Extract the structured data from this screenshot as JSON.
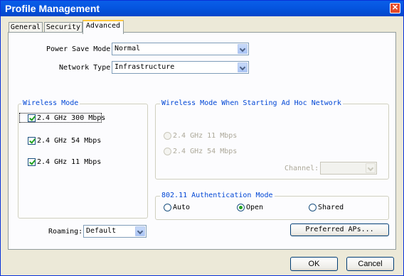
{
  "window": {
    "title": "Profile Management",
    "close_glyph": "✕"
  },
  "tabs": [
    {
      "label": "General",
      "active": false
    },
    {
      "label": "Security",
      "active": false
    },
    {
      "label": "Advanced",
      "active": true
    }
  ],
  "power_save": {
    "label": "Power Save Mode:",
    "value": "Normal"
  },
  "network_type": {
    "label": "Network Type:",
    "value": "Infrastructure"
  },
  "wireless_mode": {
    "legend": "Wireless Mode",
    "options": [
      {
        "label": "2.4 GHz 300 Mbps",
        "checked": true
      },
      {
        "label": "2.4 GHz 54 Mbps",
        "checked": true
      },
      {
        "label": "2.4 GHz 11 Mbps",
        "checked": true
      }
    ]
  },
  "adhoc_mode": {
    "legend": "Wireless Mode When Starting Ad Hoc Network",
    "options": [
      {
        "label": "2.4 GHz 11 Mbps",
        "enabled": false
      },
      {
        "label": "2.4 GHz 54 Mbps",
        "enabled": false
      }
    ],
    "channel_label": "Channel:",
    "channel_value": ""
  },
  "auth_mode": {
    "legend": "802.11 Authentication Mode",
    "options": [
      {
        "label": "Auto",
        "selected": false
      },
      {
        "label": "Open",
        "selected": true
      },
      {
        "label": "Shared",
        "selected": false
      }
    ]
  },
  "roaming": {
    "label": "Roaming:",
    "value": "Default"
  },
  "buttons": {
    "preferred_aps": "Preferred APs...",
    "ok": "OK",
    "cancel": "Cancel"
  },
  "colors": {
    "titlebar": "#0555e0",
    "legend_text": "#0046d5",
    "check_mark": "#21a121",
    "dialog_bg": "#ece9d8"
  }
}
